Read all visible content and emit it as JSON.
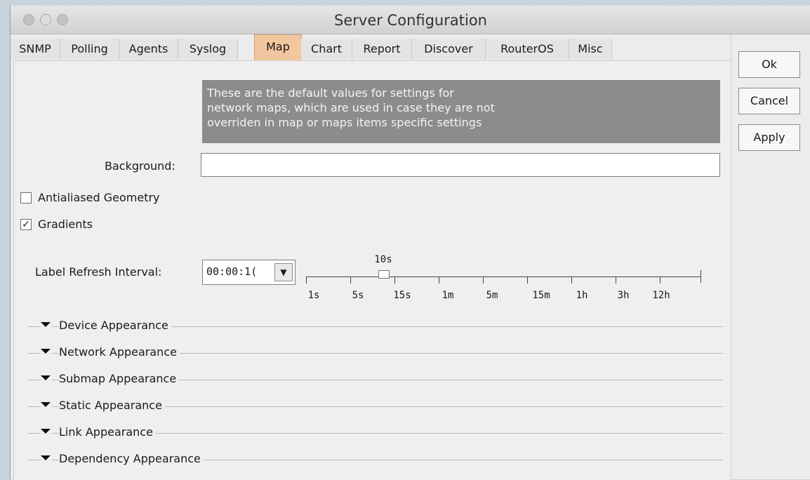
{
  "window": {
    "title": "Server Configuration"
  },
  "tabs": [
    {
      "label": "SNMP"
    },
    {
      "label": "Polling"
    },
    {
      "label": "Agents"
    },
    {
      "label": "Syslog"
    },
    {
      "label": "Map",
      "active": true
    },
    {
      "label": "Chart"
    },
    {
      "label": "Report"
    },
    {
      "label": "Discover"
    },
    {
      "label": "RouterOS"
    },
    {
      "label": "Misc"
    }
  ],
  "note": {
    "line1": "These are the default values for settings for",
    "line2": "network maps, which are used in case they are not",
    "line3": "overriden in map or maps items specific settings"
  },
  "background": {
    "label": "Background:",
    "value": ""
  },
  "checkboxes": {
    "antialiased": {
      "label": "Antialiased Geometry",
      "checked": false,
      "mark": ""
    },
    "gradients": {
      "label": "Gradients",
      "checked": true,
      "mark": "✓"
    }
  },
  "label_refresh": {
    "label": "Label Refresh Interval:",
    "value": "00:00:1(",
    "slider_value_label": "10s",
    "tick_labels": [
      "1s",
      "5s",
      "15s",
      "1m",
      "5m",
      "15m",
      "1h",
      "3h",
      "12h"
    ]
  },
  "sections": [
    {
      "label": "Device Appearance"
    },
    {
      "label": "Network Appearance"
    },
    {
      "label": "Submap Appearance"
    },
    {
      "label": "Static Appearance"
    },
    {
      "label": "Link Appearance"
    },
    {
      "label": "Dependency Appearance"
    }
  ],
  "buttons": {
    "ok": "Ok",
    "cancel": "Cancel",
    "apply": "Apply"
  },
  "colors": {
    "active_tab": "#f2c79f",
    "note_bg": "#8c8c8c"
  },
  "icons": {
    "combo_arrow": "chevron-down-icon",
    "section_arrow": "triangle-down-icon"
  }
}
